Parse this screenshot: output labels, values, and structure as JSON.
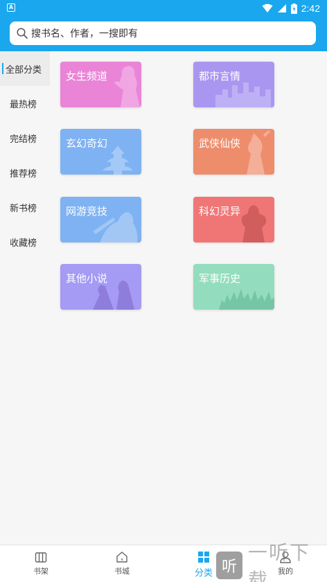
{
  "status_bar": {
    "time": "2:42",
    "app_badge": "A"
  },
  "search": {
    "placeholder": "搜书名、作者，一搜即有"
  },
  "sidebar": {
    "items": [
      {
        "label": "全部分类",
        "active": true
      },
      {
        "label": "最热榜",
        "active": false
      },
      {
        "label": "完结榜",
        "active": false
      },
      {
        "label": "推荐榜",
        "active": false
      },
      {
        "label": "新书榜",
        "active": false
      },
      {
        "label": "收藏榜",
        "active": false
      }
    ]
  },
  "categories": [
    {
      "label": "女生频道",
      "color": "#ea84d7",
      "icon": "female-silhouette-icon"
    },
    {
      "label": "都市言情",
      "color": "#a996f0",
      "icon": "city-skyline-icon"
    },
    {
      "label": "玄幻奇幻",
      "color": "#7fb2f2",
      "icon": "pagoda-icon"
    },
    {
      "label": "武侠仙侠",
      "color": "#ee8d6c",
      "icon": "swordsman-icon"
    },
    {
      "label": "网游竞技",
      "color": "#7fb2f2",
      "icon": "warrior-icon"
    },
    {
      "label": "科幻灵异",
      "color": "#f07676",
      "icon": "robot-icon"
    },
    {
      "label": "其他小说",
      "color": "#a59af4",
      "icon": "fighters-icon"
    },
    {
      "label": "军事历史",
      "color": "#93ddbe",
      "icon": "army-icon"
    }
  ],
  "bottom_nav": [
    {
      "label": "书架",
      "icon": "bookshelf-icon",
      "active": false
    },
    {
      "label": "书城",
      "icon": "home-icon",
      "active": false
    },
    {
      "label": "分类",
      "icon": "category-grid-icon",
      "active": true
    },
    {
      "label": "我的",
      "icon": "profile-icon",
      "active": false
    }
  ],
  "watermark": {
    "glyph": "听",
    "text": "一听下载"
  },
  "colors": {
    "accent": "#1aa7ee",
    "background": "#f6f6f6"
  }
}
